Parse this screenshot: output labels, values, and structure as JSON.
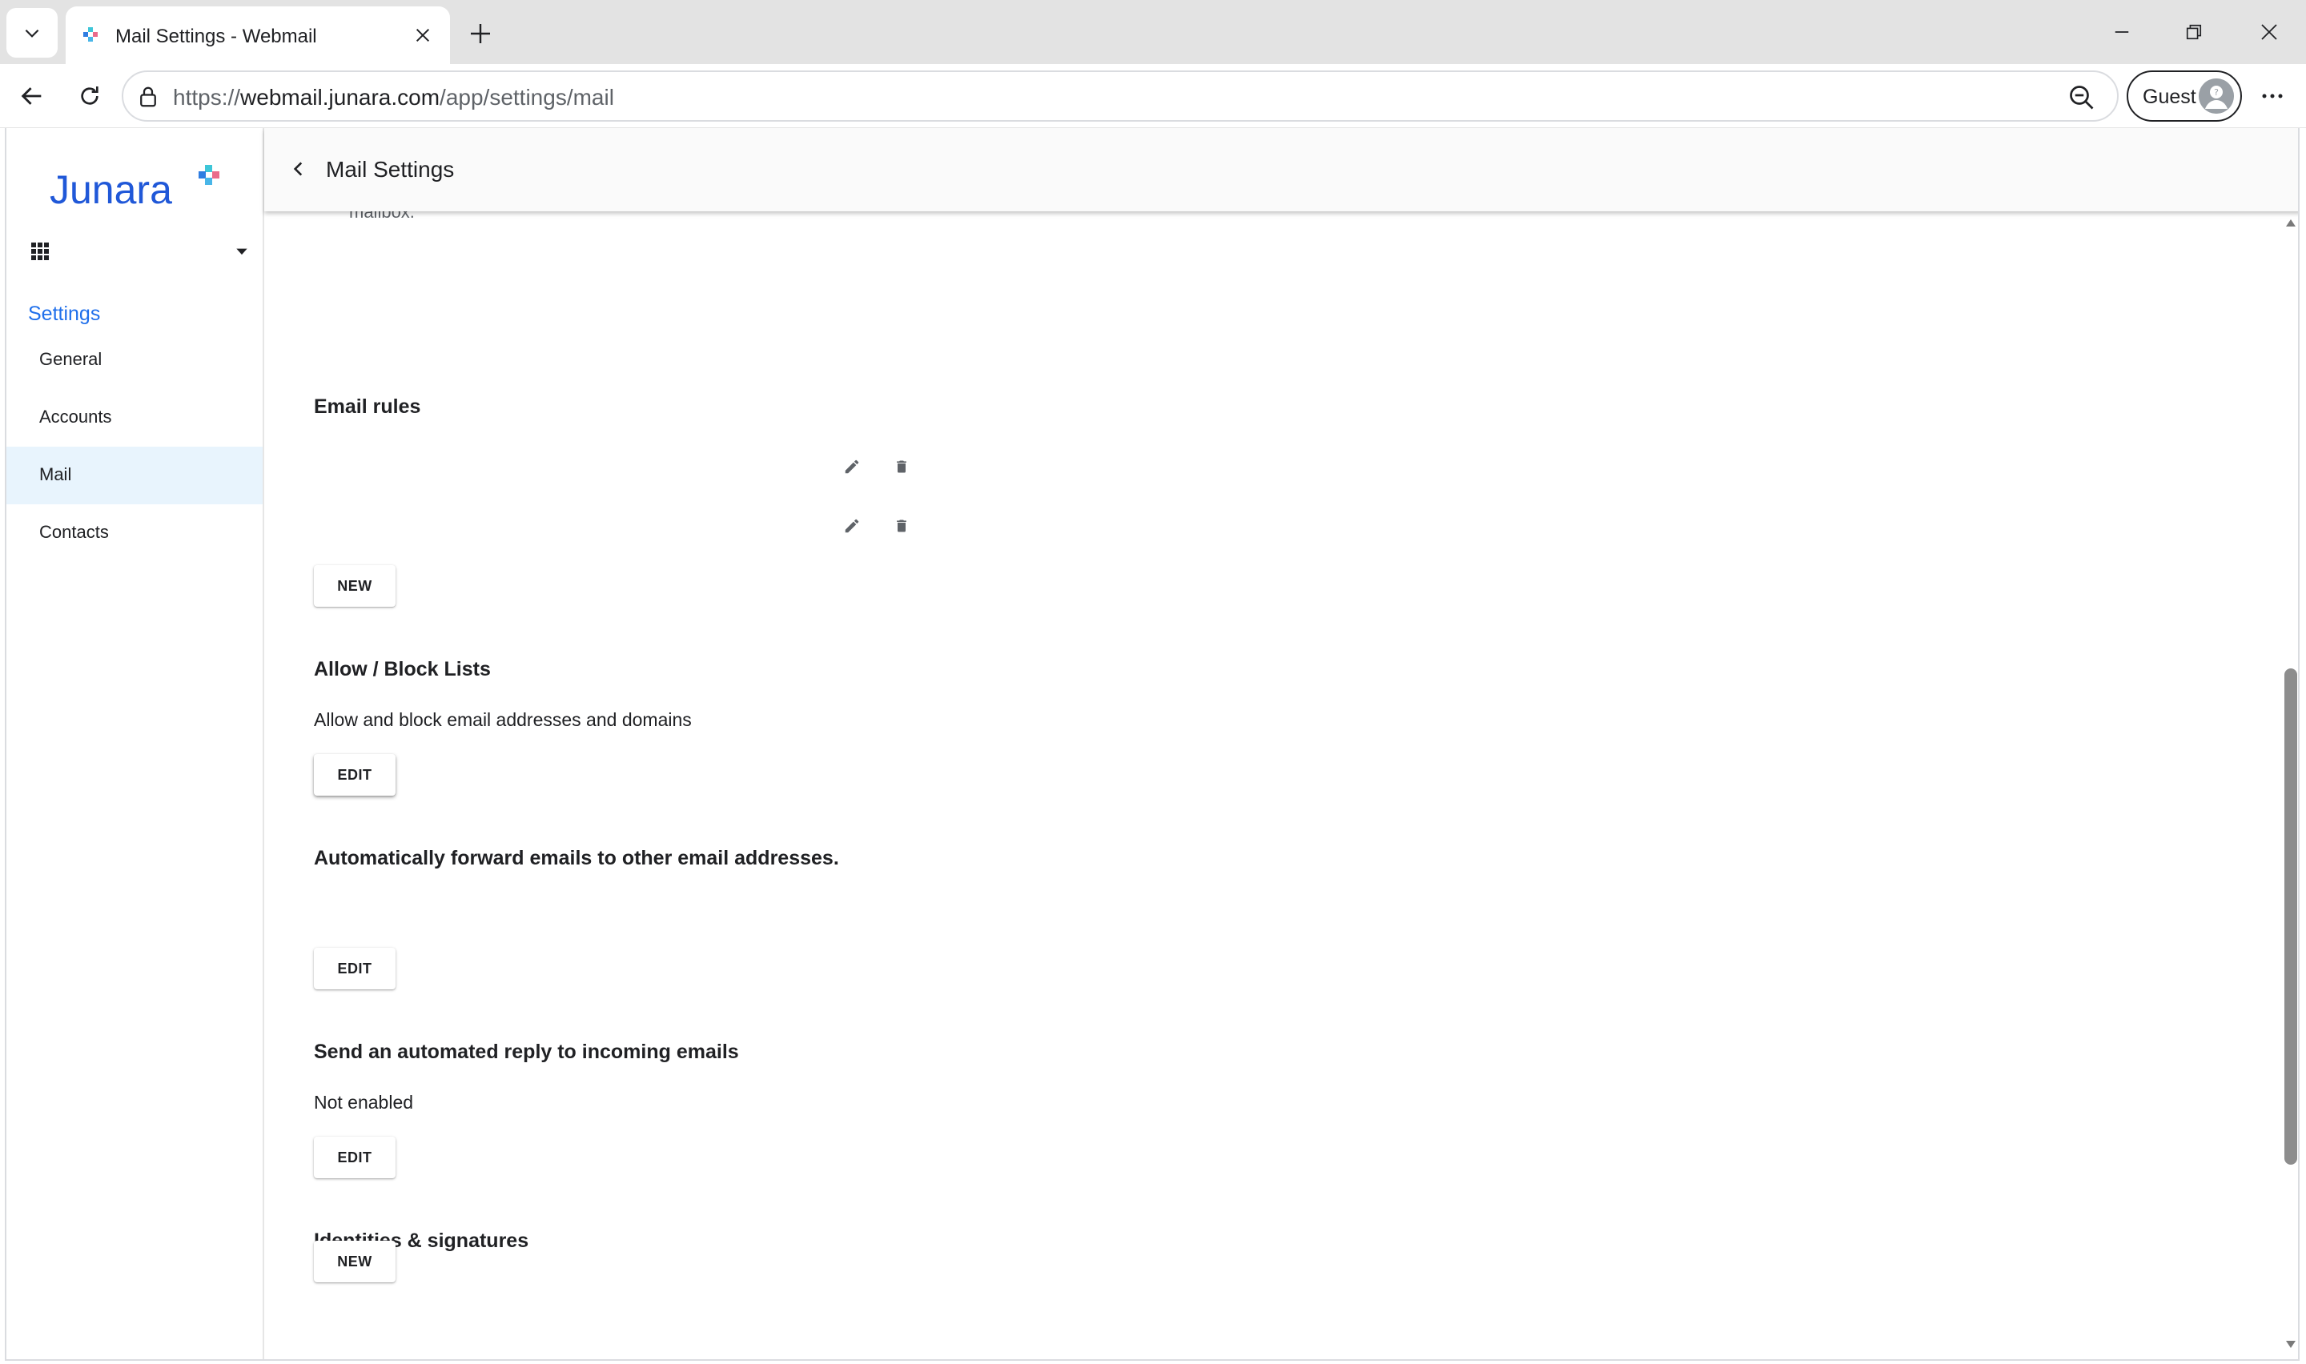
{
  "browser": {
    "tab_title": "Mail Settings - Webmail",
    "url_scheme": "https://",
    "url_host": "webmail.junara.com",
    "url_path": "/app/settings/mail",
    "profile_label": "Guest"
  },
  "sidebar": {
    "logo_text": "Junara",
    "settings_title": "Settings",
    "items": [
      {
        "label": "General"
      },
      {
        "label": "Accounts"
      },
      {
        "label": "Mail"
      },
      {
        "label": "Contacts"
      }
    ],
    "active_item": "Mail"
  },
  "header": {
    "title": "Mail Settings"
  },
  "content": {
    "cut_off_text": "mailbox.",
    "email_rules": {
      "title": "Email rules",
      "new_label": "NEW"
    },
    "allow_block": {
      "title": "Allow / Block Lists",
      "description": "Allow and block email addresses and domains",
      "edit_label": "EDIT"
    },
    "forward": {
      "title": "Automatically forward emails to other email addresses.",
      "edit_label": "EDIT"
    },
    "auto_reply": {
      "title": "Send an automated reply to incoming emails",
      "status": "Not enabled",
      "edit_label": "EDIT"
    },
    "identities": {
      "title": "Identities & signatures",
      "new_label": "NEW"
    }
  },
  "scrollbar": {
    "position_fraction": 0.72
  },
  "colors": {
    "accent": "#1f6feb",
    "logo_blue": "#2058d8",
    "active_item_bg": "#e8f4fd"
  }
}
